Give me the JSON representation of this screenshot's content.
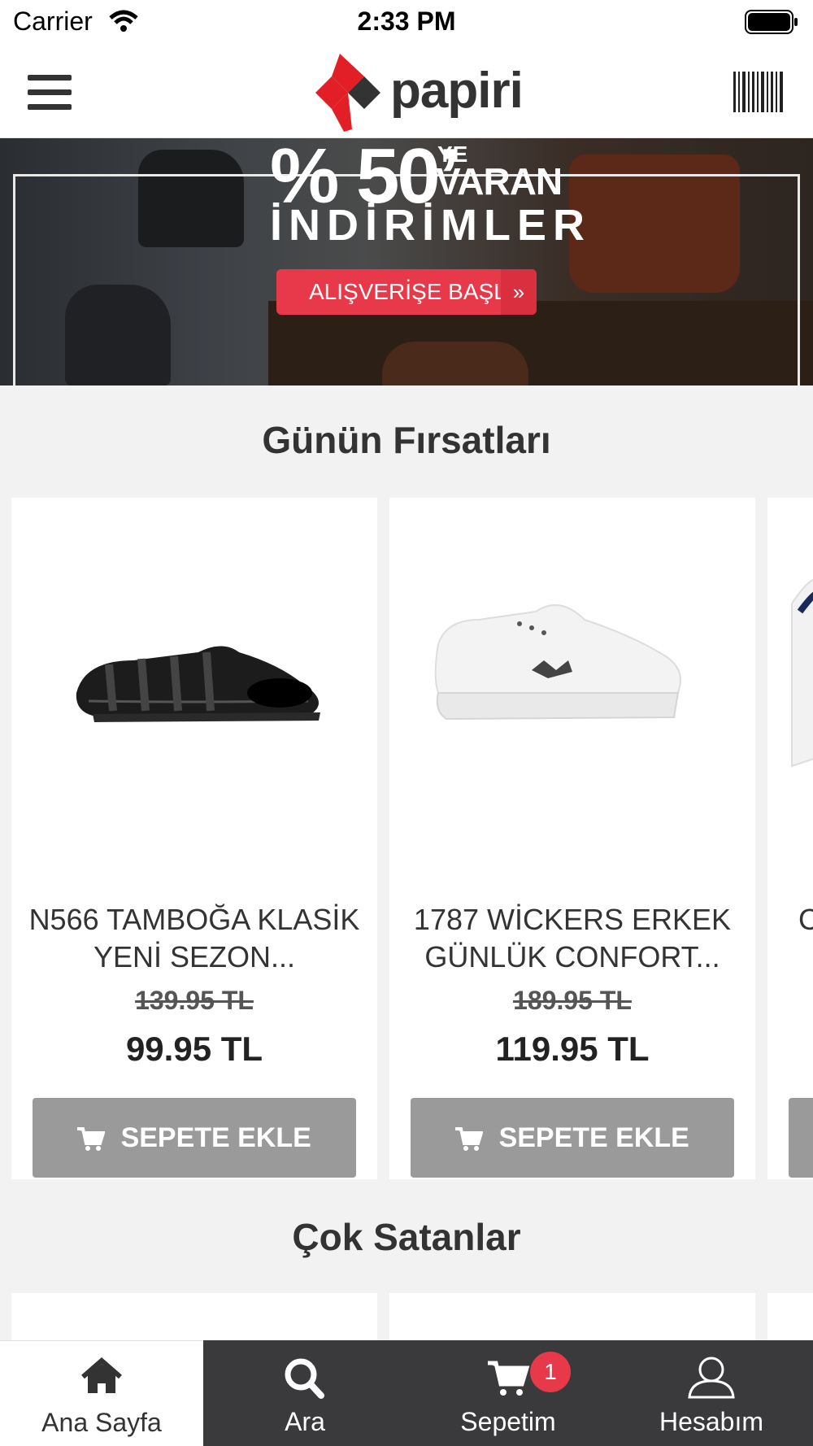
{
  "status_bar": {
    "carrier": "Carrier",
    "time": "2:33 PM"
  },
  "header": {
    "logo_text": "papiri",
    "menu_icon": "hamburger-menu-icon",
    "barcode_icon": "barcode-icon"
  },
  "banner": {
    "line1": "% 50’",
    "ye": "YE",
    "varan": "VARAN",
    "line2": "İNDİRİMLER",
    "cta_label": "ALIŞVERİŞE BAŞLA",
    "cta_arrow": "»"
  },
  "sections": {
    "deals_title": "Günün Fırsatları",
    "bestsellers_title": "Çok Satanlar"
  },
  "products": [
    {
      "name": "N566 TAMBOĞA KLASİK YENİ SEZON...",
      "old_price": "139.95 TL",
      "price": "99.95 TL",
      "button": "SEPETE EKLE"
    },
    {
      "name": "1787 WİCKERS ERKEK GÜNLÜK CONFORT...",
      "old_price": "189.95 TL",
      "price": "119.95 TL",
      "button": "SEPETE EKLE"
    },
    {
      "name": "C",
      "old_price": "",
      "price": "",
      "button": ""
    }
  ],
  "tabbar": {
    "items": [
      {
        "label": "Ana Sayfa",
        "icon": "home-icon"
      },
      {
        "label": "Ara",
        "icon": "search-icon"
      },
      {
        "label": "Sepetim",
        "icon": "cart-icon"
      },
      {
        "label": "Hesabım",
        "icon": "user-icon"
      }
    ],
    "cart_badge": "1",
    "active_color": "#ffffff",
    "inactive_bg": "#3a3a3c"
  },
  "colors": {
    "accent_red": "#e8394a",
    "button_gray": "#9a9a9a"
  }
}
